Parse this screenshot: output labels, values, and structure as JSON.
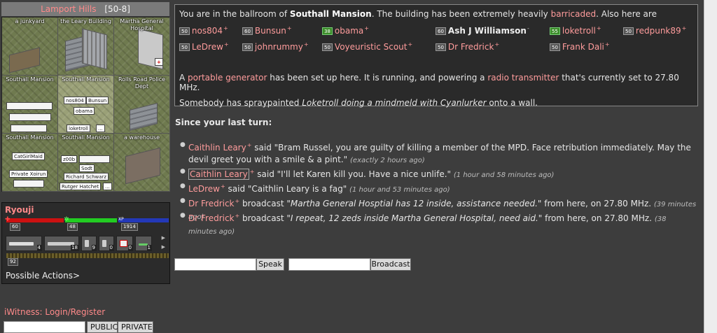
{
  "location": {
    "suburb": "Lamport Hills",
    "coords": "[50-8]"
  },
  "map": {
    "cells": [
      {
        "label": "a junkyard",
        "chips": []
      },
      {
        "label": "the Leary Building",
        "chips": []
      },
      {
        "label": "Martha General Hospital",
        "chips": []
      },
      {
        "label": "Southall Mansion",
        "chips": [
          "",
          "",
          ""
        ]
      },
      {
        "label": "Southall Mansion",
        "chips": [
          "nos804",
          "Bunsun",
          "obama",
          "loketroll",
          "..."
        ]
      },
      {
        "label": "Rolls Road Police Dept",
        "chips": []
      },
      {
        "label": "Southall Mansion",
        "chips": [
          "CatGirlMaid",
          "Private Xoirun"
        ]
      },
      {
        "label": "Southall Mansion",
        "chips": [
          "z00b",
          "Sodt",
          "Richard Schwarz",
          "Rutger Hatchet",
          "..."
        ]
      },
      {
        "label": "a warehouse",
        "chips": []
      }
    ]
  },
  "player": {
    "name": "Ryouji",
    "hp": "60",
    "ip": "48",
    "xp": "1914",
    "xp_label": "XP",
    "ap": "92",
    "inventory": [
      {
        "icon": "pistol-icon",
        "qty": "4"
      },
      {
        "icon": "shotgun-icon",
        "qty": "18"
      },
      {
        "icon": "clip-icon",
        "qty": "9"
      },
      {
        "icon": "item-icon",
        "qty": "0"
      },
      {
        "icon": "first-aid-kit-icon",
        "qty": "0"
      },
      {
        "icon": "syringe-icon",
        "qty": "1"
      }
    ],
    "possible_actions": "Possible Actions>"
  },
  "iwitness": {
    "label": "iWitness:",
    "link": "Login/Register",
    "public": "PUBLIC",
    "private": "PRIVATE"
  },
  "description": {
    "intro": "You are in the ballroom of",
    "building": "Southall Mansion",
    "mid": ". The building has been extremely heavily",
    "barricaded": "barricaded",
    "tail": ". Also here are",
    "people": [
      {
        "level": "50",
        "name": "nos804",
        "mark": "+",
        "style": "red",
        "green": false
      },
      {
        "level": "60",
        "name": "Bunsun",
        "mark": "+",
        "style": "red",
        "green": false
      },
      {
        "level": "38",
        "name": "obama",
        "mark": "+",
        "style": "red",
        "green": true
      },
      {
        "level": "60",
        "name": "Ash J Williamson",
        "mark": "-",
        "style": "plain",
        "green": false
      },
      {
        "level": "55",
        "name": "loketroll",
        "mark": "+",
        "style": "red",
        "green": true
      },
      {
        "level": "50",
        "name": "redpunk89",
        "mark": "+",
        "style": "red",
        "green": false
      },
      {
        "level": "50",
        "name": "LeDrew",
        "mark": "+",
        "style": "red",
        "green": false
      },
      {
        "level": "50",
        "name": "johnrummy",
        "mark": "+",
        "style": "red",
        "green": false
      },
      {
        "level": "50",
        "name": "Voyeuristic Scout",
        "mark": "+",
        "style": "red",
        "green": false
      },
      {
        "level": "50",
        "name": "Dr Fredrick",
        "mark": "+",
        "style": "red",
        "green": false
      },
      {
        "level": "50",
        "name": "Frank Dali",
        "mark": "+",
        "style": "red",
        "green": false
      }
    ],
    "gen_a": "A",
    "gen_item": "portable generator",
    "gen_mid": "has been set up here. It is running, and powering a",
    "gen_radio": "radio transmitter",
    "gen_tail": "that's currently set to 27.80 MHz.",
    "spray_intro": "Somebody has spraypainted",
    "spray_text": "Loketroll doing a mindmeld with Cyanlurker",
    "spray_tail": "onto a wall."
  },
  "since": "Since your last turn:",
  "events": [
    {
      "who": "Caithlin Leary",
      "mark": "+",
      "verb": "said",
      "text": "\"Bram Russel, you are guilty of killing a member of the MPD. Face retribution immediately. May the devil greet you with a smile & a pint.\"",
      "italic": false,
      "after": "",
      "ago": "(exactly 2 hours ago)"
    },
    {
      "who": "Caithlin Leary",
      "mark": "+",
      "verb": "said",
      "text": "\"I'll let Karen kill you. Have a nice unlife.\"",
      "italic": false,
      "after": "",
      "ago": "(1 hour and 58 minutes ago)"
    },
    {
      "who": "LeDrew",
      "mark": "+",
      "verb": "said",
      "text": "\"Caithlin Leary is a fag\"",
      "italic": false,
      "after": "",
      "ago": "(1 hour and 53 minutes ago)"
    },
    {
      "who": "Dr Fredrick",
      "mark": "+",
      "verb": "broadcast",
      "text": "\"Martha General Hosptial has 12 inside, assistance needed.\"",
      "italic": true,
      "after": "from here, on 27.80 MHz.",
      "ago": "(39 minutes ago)"
    },
    {
      "who": "Dr Fredrick",
      "mark": "+",
      "verb": "broadcast",
      "text": "\"I repeat, 12 zeds inside Martha General Hospital, need aid.\"",
      "italic": true,
      "after": "from here, on 27.80 MHz.",
      "ago": "(38 minutes ago)"
    }
  ],
  "controls": {
    "speak": "Speak",
    "broadcast": "Broadcast"
  }
}
